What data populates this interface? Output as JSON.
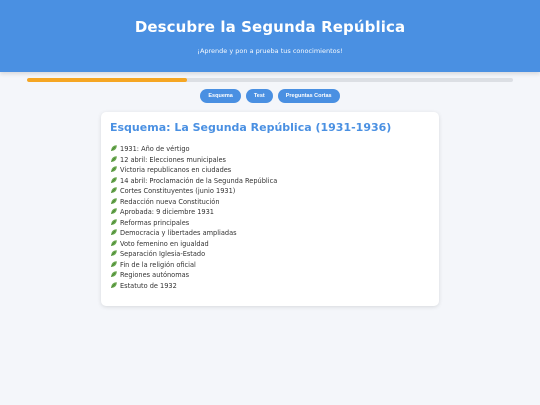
{
  "header": {
    "title": "Descubre la Segunda República",
    "subtitle": "¡Aprende y pon a prueba tus conocimientos!"
  },
  "progress": {
    "percent": 33,
    "color": "#f5a623"
  },
  "colors": {
    "primary": "#4a90e2",
    "accent": "#f5a623",
    "leaf": "#6aa84f"
  },
  "nav": {
    "buttons": [
      {
        "label": "Esquema"
      },
      {
        "label": "Test"
      },
      {
        "label": "Preguntas Cortas"
      }
    ]
  },
  "card": {
    "title": "Esquema: La Segunda República (1931-1936)",
    "item_icon": "leaf-icon",
    "items": [
      "1931: Año de vértigo",
      "12 abril: Elecciones municipales",
      "Victoria republicanos en ciudades",
      "14 abril: Proclamación de la Segunda República",
      "Cortes Constituyentes (junio 1931)",
      "Redacción nueva Constitución",
      "Aprobada: 9 diciembre 1931",
      "Reformas principales",
      "Democracia y libertades ampliadas",
      "Voto femenino en igualdad",
      "Separación Iglesia-Estado",
      "Fin de la religión oficial",
      "Regiones autónomas",
      "Estatuto de 1932"
    ]
  }
}
